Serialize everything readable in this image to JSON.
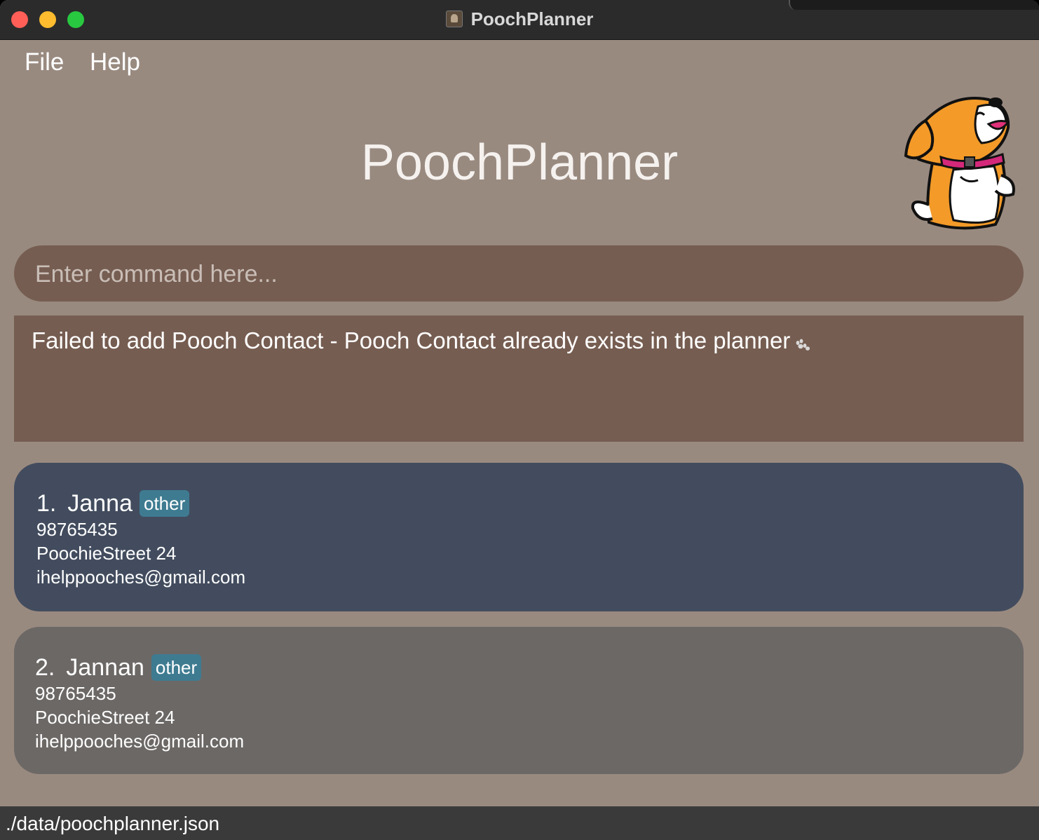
{
  "window": {
    "title": "PoochPlanner"
  },
  "menu": {
    "file_label": "File",
    "help_label": "Help"
  },
  "app": {
    "title": "PoochPlanner"
  },
  "command": {
    "placeholder": "Enter command here...",
    "value": ""
  },
  "result": {
    "message": "Failed to add Pooch Contact - Pooch Contact already exists in the planner"
  },
  "contacts": [
    {
      "index": "1.",
      "name": "Janna",
      "tag": "other",
      "phone": "98765435",
      "address": "PoochieStreet 24",
      "email": "ihelppooches@gmail.com"
    },
    {
      "index": "2.",
      "name": "Jannan",
      "tag": "other",
      "phone": "98765435",
      "address": "PoochieStreet 24",
      "email": "ihelppooches@gmail.com"
    }
  ],
  "status": {
    "file_path": "./data/poochplanner.json"
  },
  "colors": {
    "background": "#998A80",
    "command_box": "#765D51",
    "selected_card": "#424C5E",
    "card": "#6C6866",
    "tag": "#3E7B91",
    "statusbar": "#3A3A3A"
  },
  "icons": {
    "mascot": "dog-mascot-icon",
    "paw": "paw-icon"
  }
}
